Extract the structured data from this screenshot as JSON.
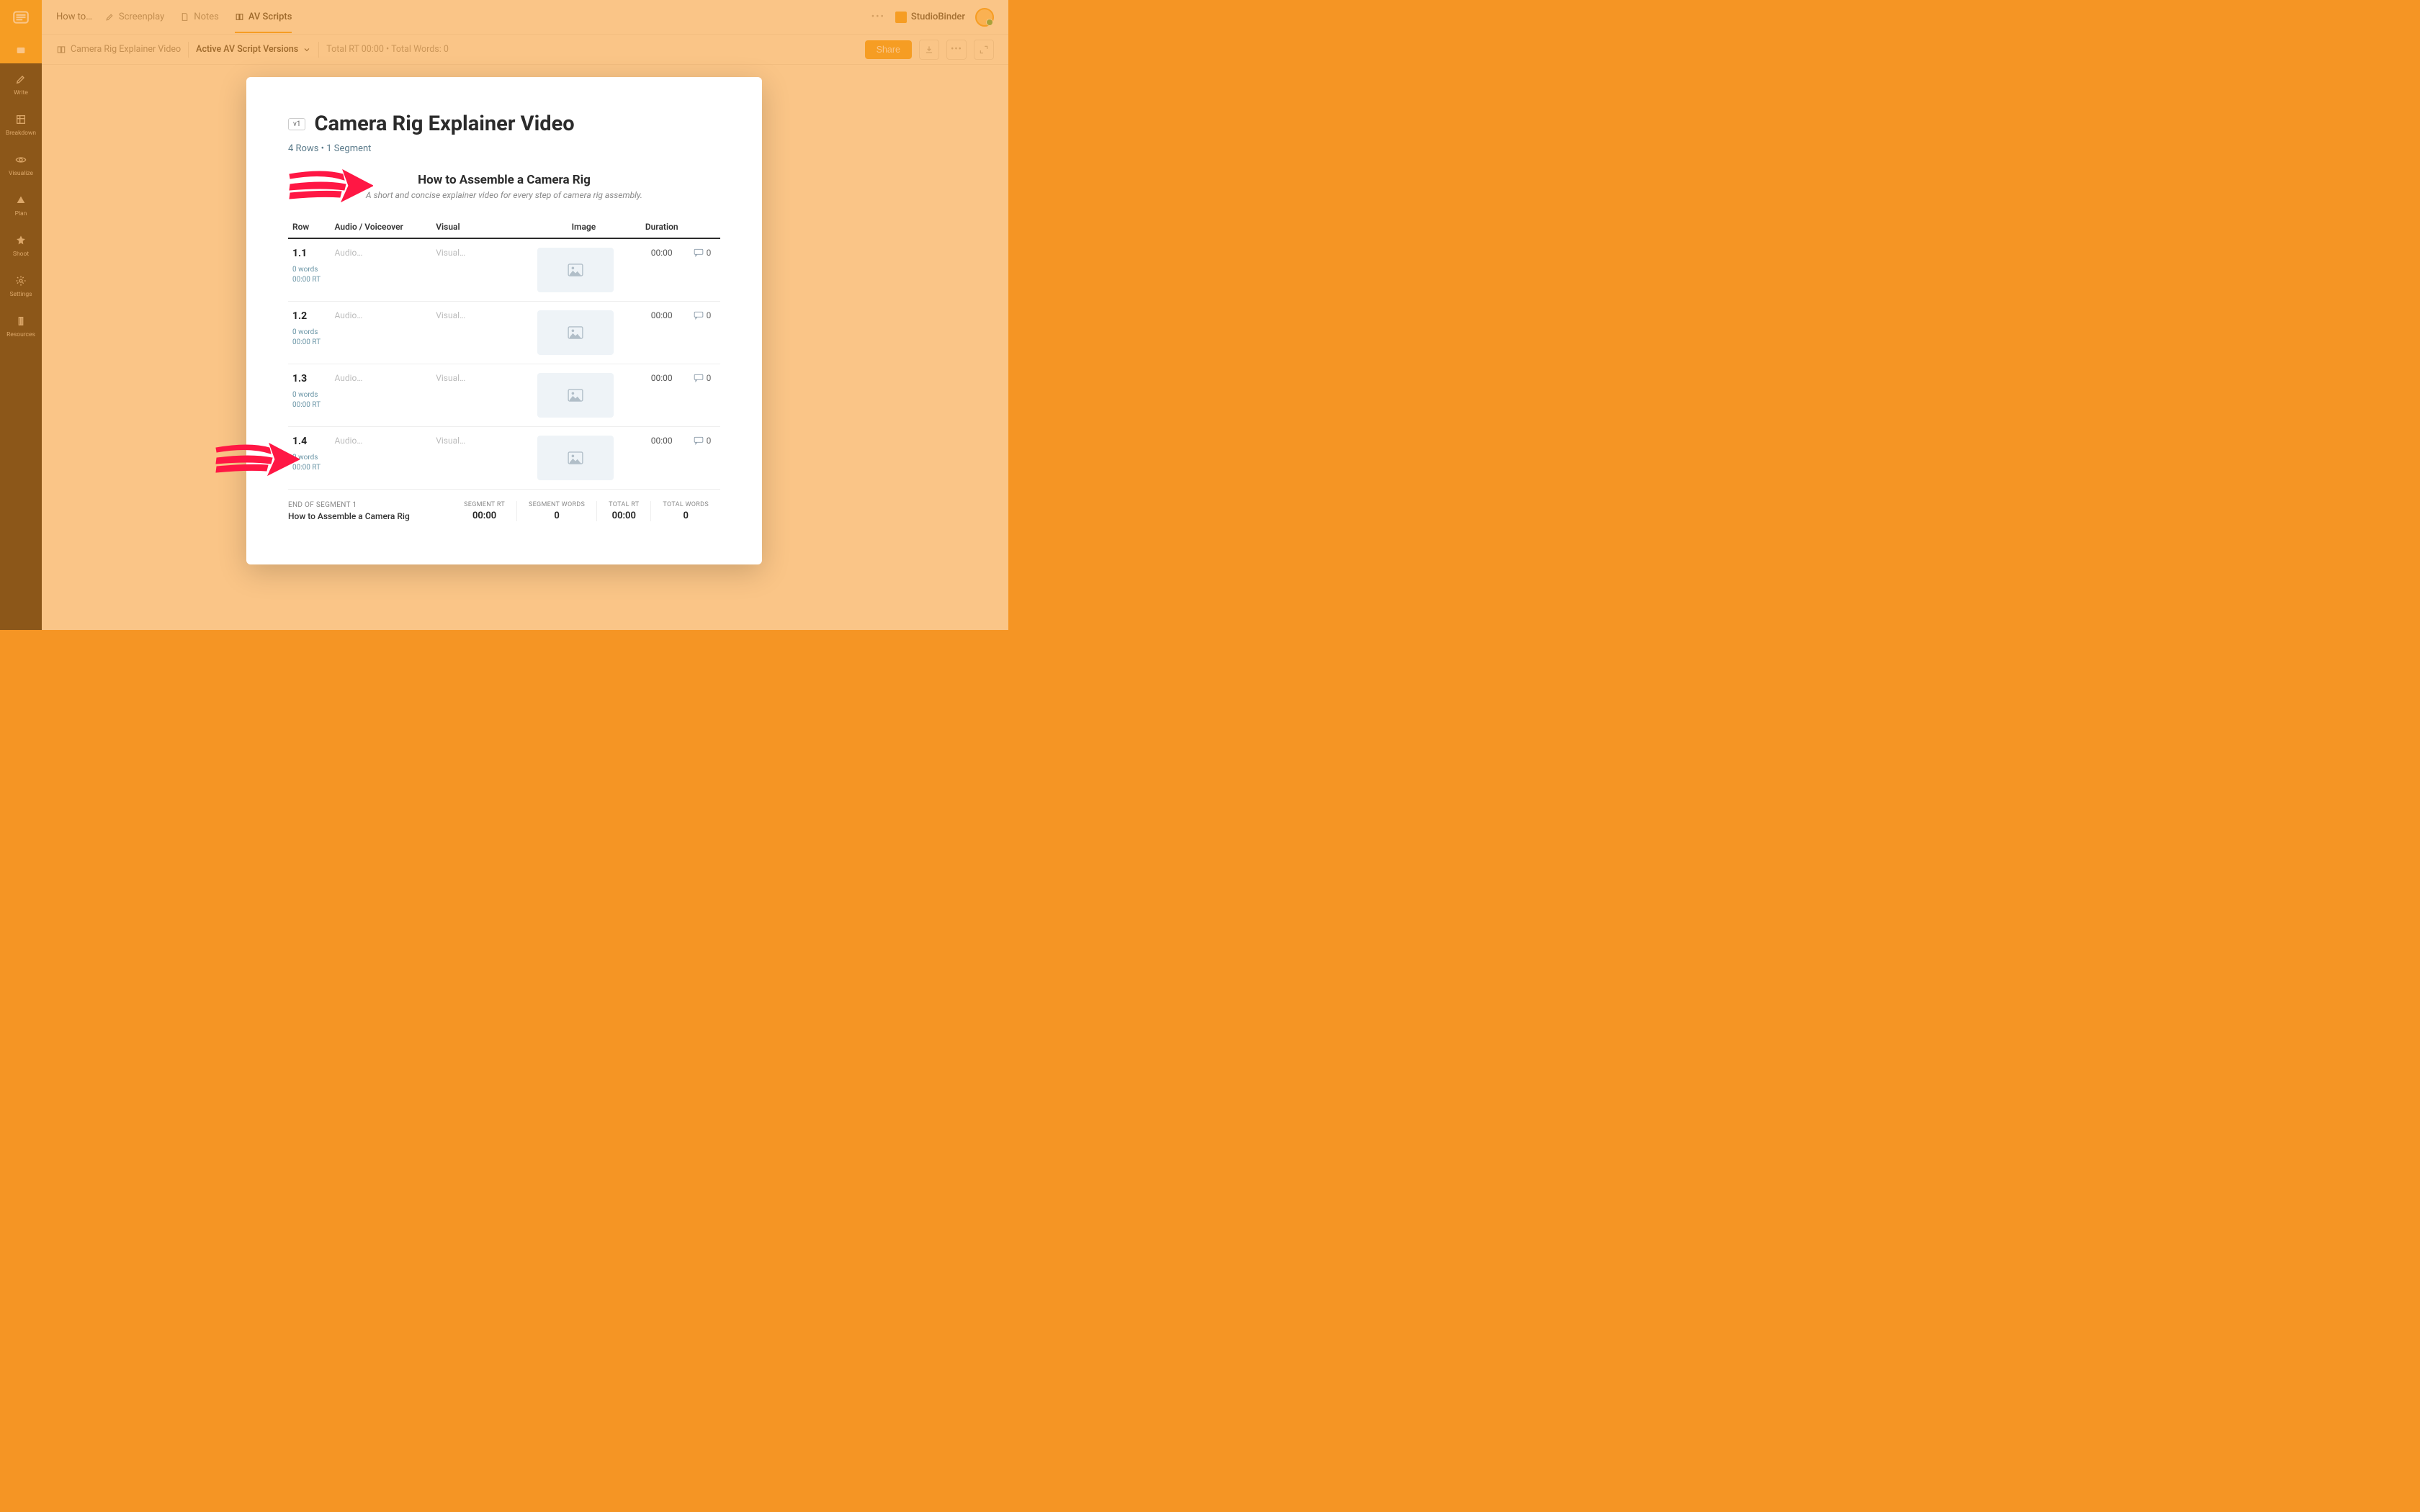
{
  "brand_name": "StudioBinder",
  "header": {
    "how_to": "How to…",
    "tabs": [
      {
        "label": "Screenplay"
      },
      {
        "label": "Notes"
      },
      {
        "label": "AV Scripts"
      }
    ]
  },
  "subheader": {
    "doc_title": "Camera Rig Explainer Video",
    "version_label": "Active AV Script Versions",
    "stats": "Total RT 00:00 • Total Words: 0",
    "share": "Share"
  },
  "rail": [
    {
      "label": ""
    },
    {
      "label": "Write"
    },
    {
      "label": "Breakdown"
    },
    {
      "label": "Visualize"
    },
    {
      "label": "Plan"
    },
    {
      "label": "Shoot"
    },
    {
      "label": "Settings"
    },
    {
      "label": "Resources"
    }
  ],
  "card": {
    "vchip": "v1",
    "title": "Camera Rig Explainer Video",
    "subtitle": "4 Rows • 1 Segment",
    "segment_title": "How to Assemble a Camera Rig",
    "segment_desc": "A short and concise explainer video for every step of camera rig assembly.",
    "columns": {
      "row": "Row",
      "audio": "Audio / Voiceover",
      "visual": "Visual",
      "image": "Image",
      "duration": "Duration"
    },
    "rows": [
      {
        "num": "1.1",
        "words": "0 words",
        "rt": "00:00 RT",
        "audio": "Audio…",
        "visual": "Visual…",
        "duration": "00:00",
        "comments": "0"
      },
      {
        "num": "1.2",
        "words": "0 words",
        "rt": "00:00 RT",
        "audio": "Audio…",
        "visual": "Visual…",
        "duration": "00:00",
        "comments": "0"
      },
      {
        "num": "1.3",
        "words": "0 words",
        "rt": "00:00 RT",
        "audio": "Audio…",
        "visual": "Visual…",
        "duration": "00:00",
        "comments": "0"
      },
      {
        "num": "1.4",
        "words": "0 words",
        "rt": "00:00 RT",
        "audio": "Audio…",
        "visual": "Visual…",
        "duration": "00:00",
        "comments": "0"
      }
    ],
    "footer": {
      "end_label": "END OF SEGMENT 1",
      "end_name": "How to Assemble a Camera Rig",
      "stats": [
        {
          "label": "SEGMENT RT",
          "value": "00:00"
        },
        {
          "label": "SEGMENT WORDS",
          "value": "0"
        },
        {
          "label": "TOTAL RT",
          "value": "00:00"
        },
        {
          "label": "TOTAL WORDS",
          "value": "0"
        }
      ]
    }
  }
}
